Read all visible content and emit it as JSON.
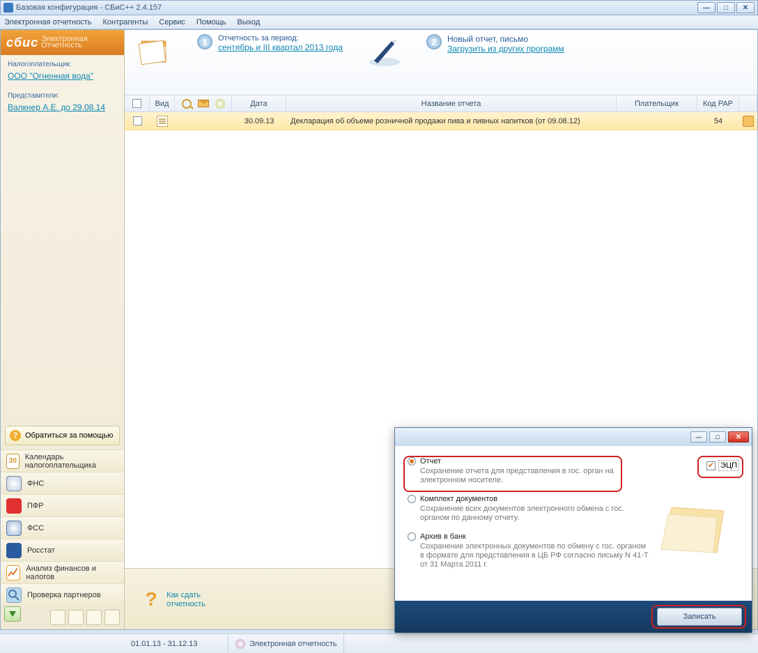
{
  "window": {
    "title": "Базовая конфигурация - СБиС++ 2.4.157"
  },
  "menu": {
    "m1": "Электронная отчетность",
    "m2": "Контрагенты",
    "m3": "Сервис",
    "m4": "Помощь",
    "m5": "Выход"
  },
  "logo": {
    "brand": "сбис",
    "sub1": "Электронная",
    "sub2": "Отчетность"
  },
  "taxpayer": {
    "label": "Налогоплательщик:",
    "name": "ООО \"Огненная вода\""
  },
  "representatives": {
    "label": "Представители:",
    "name": "Валкнер А.Е. до 29.08.14"
  },
  "help_btn": "Обратиться за помощью",
  "nav": {
    "calendar": "Календарь налогоплательщика",
    "fns": "ФНС",
    "pfr": "ПФР",
    "fss": "ФСС",
    "rosstat": "Росстат",
    "finance": "Анализ финансов и налогов",
    "partners": "Проверка партнеров"
  },
  "steps": {
    "s1_title": "Отчетность за период:",
    "s1_link": "сентябрь и III квартал 2013 года",
    "s2_title": "Новый отчет, письмо",
    "s2_link": "Загрузить из других программ"
  },
  "grid": {
    "h_type": "Вид",
    "h_date": "Дата",
    "h_name": "Название отчета",
    "h_payer": "Плательщик",
    "h_code": "Код РАР"
  },
  "row": {
    "date": "30.09.13",
    "name": "Декларация об объеме розничной продажи пива и пивных напитков (от 09.08.12)",
    "code": "54"
  },
  "bottom": {
    "howto1": "Как сдать",
    "howto2": "отчетность"
  },
  "status": {
    "period": "01.01.13 - 31.12.13",
    "module": "Электронная отчетность"
  },
  "dialog": {
    "ecp": "ЭЦП",
    "opt1": {
      "label": "Отчет",
      "desc": "Сохранение отчета для представления в гос. орган на электронном носителе."
    },
    "opt2": {
      "label": "Комплект документов",
      "desc": "Сохранение всех документов электронного обмена с гос. органом по данному отчету."
    },
    "opt3": {
      "label": "Архив в банк",
      "desc": "Сохранение электронных документов по обмену с гос. органом в формате для представления в ЦБ РФ согласно письму N 41-Т от 31 Марта 2011 г."
    },
    "submit": "Записать"
  }
}
